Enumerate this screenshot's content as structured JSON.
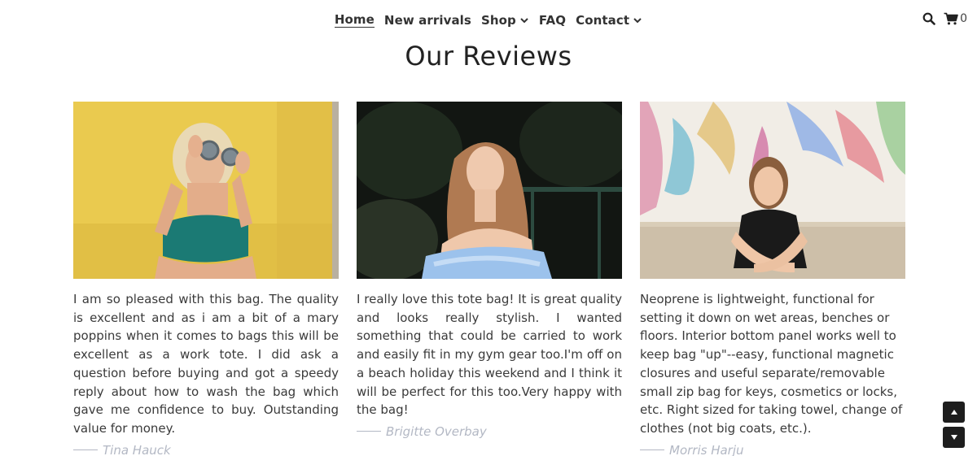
{
  "nav": {
    "items": [
      {
        "label": "Home",
        "active": true,
        "dropdown": false
      },
      {
        "label": "New arrivals",
        "active": false,
        "dropdown": false
      },
      {
        "label": "Shop",
        "active": false,
        "dropdown": true
      },
      {
        "label": "FAQ",
        "active": false,
        "dropdown": false
      },
      {
        "label": "Contact",
        "active": false,
        "dropdown": true
      }
    ]
  },
  "header": {
    "search_icon": "search-icon",
    "cart_icon": "cart-icon",
    "cart_count": "0"
  },
  "page": {
    "title": "Our Reviews"
  },
  "reviews": [
    {
      "text": "I am so pleased with this bag. The quality is excellent and as i am a bit of a mary poppins when it comes to bags this will be excellent as a work tote. I did ask a question before buying and got a speedy reply about how to wash the bag which gave me confidence to buy. Outstanding value for money.",
      "author": "Tina Hauck"
    },
    {
      "text": "I really love this tote bag! It is great quality and looks really stylish. I wanted something that could be carried to work and easily fit in my gym gear too.I'm off on a beach holiday this weekend and I think it will be perfect for this too.Very happy with the bag!",
      "author": "Brigitte Overbay"
    },
    {
      "text": "Neoprene is lightweight, functional for setting it down on wet areas, benches or floors. Interior bottom panel works well to keep bag \"up\"--easy, functional magnetic closures and useful separate/removable small zip bag for keys, cosmetics or locks, etc. Right sized for taking towel, change of clothes (not big coats, etc.).",
      "author": "Morris Harju"
    }
  ],
  "colors": {
    "text": "#333333",
    "author": "#b3b8c4",
    "scroll_button": "#1e1e1e"
  }
}
